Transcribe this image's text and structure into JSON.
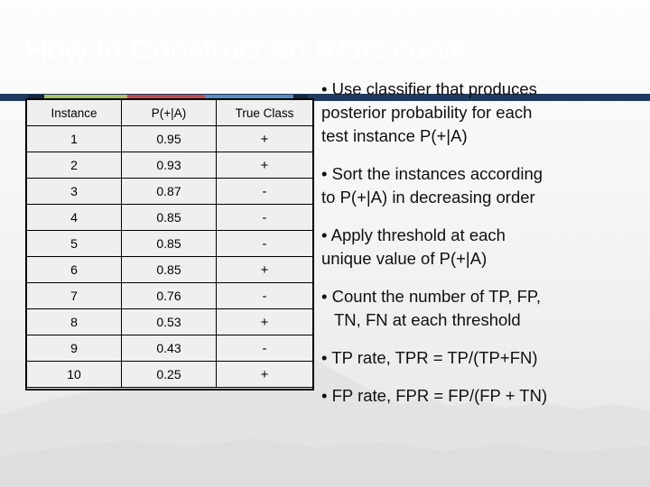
{
  "slide": {
    "title": "How to Construct an ROC curve",
    "accent_colors": {
      "green": "#a9c162",
      "red": "#c24b52",
      "blue": "#5a8ec0",
      "navy": "#1f3a5f",
      "tan": "#c9b36a",
      "dark": "#15263d"
    }
  },
  "table": {
    "headers": [
      "Instance",
      "P(+|A)",
      "True Class"
    ],
    "rows": [
      {
        "instance": "1",
        "prob": "0.95",
        "true_class": "+"
      },
      {
        "instance": "2",
        "prob": "0.93",
        "true_class": "+"
      },
      {
        "instance": "3",
        "prob": "0.87",
        "true_class": "-"
      },
      {
        "instance": "4",
        "prob": "0.85",
        "true_class": "-"
      },
      {
        "instance": "5",
        "prob": "0.85",
        "true_class": "-"
      },
      {
        "instance": "6",
        "prob": "0.85",
        "true_class": "+"
      },
      {
        "instance": "7",
        "prob": "0.76",
        "true_class": "-"
      },
      {
        "instance": "8",
        "prob": "0.53",
        "true_class": "+"
      },
      {
        "instance": "9",
        "prob": "0.43",
        "true_class": "-"
      },
      {
        "instance": "10",
        "prob": "0.25",
        "true_class": "+"
      }
    ]
  },
  "bullets": [
    {
      "marker": "•",
      "line1": "Use classifier that produces",
      "line2": "posterior probability for each",
      "line3": "test instance P(+|A)"
    },
    {
      "marker": "•",
      "line1": "Sort the instances according",
      "line2": "to P(+|A) in decreasing order",
      "line3": ""
    },
    {
      "marker": "•",
      "line1": "Apply threshold at each",
      "line2": "unique value of P(+|A)",
      "line3": ""
    },
    {
      "marker": "•",
      "line1": "Count the number of TP, FP,",
      "line2": "TN, FN at each threshold",
      "line3": ""
    },
    {
      "marker": "•",
      "line1": "TP rate, TPR = TP/(TP+FN)",
      "line2": "",
      "line3": ""
    },
    {
      "marker": "•",
      "line1": "FP rate, FPR = FP/(FP + TN)",
      "line2": "",
      "line3": ""
    }
  ]
}
